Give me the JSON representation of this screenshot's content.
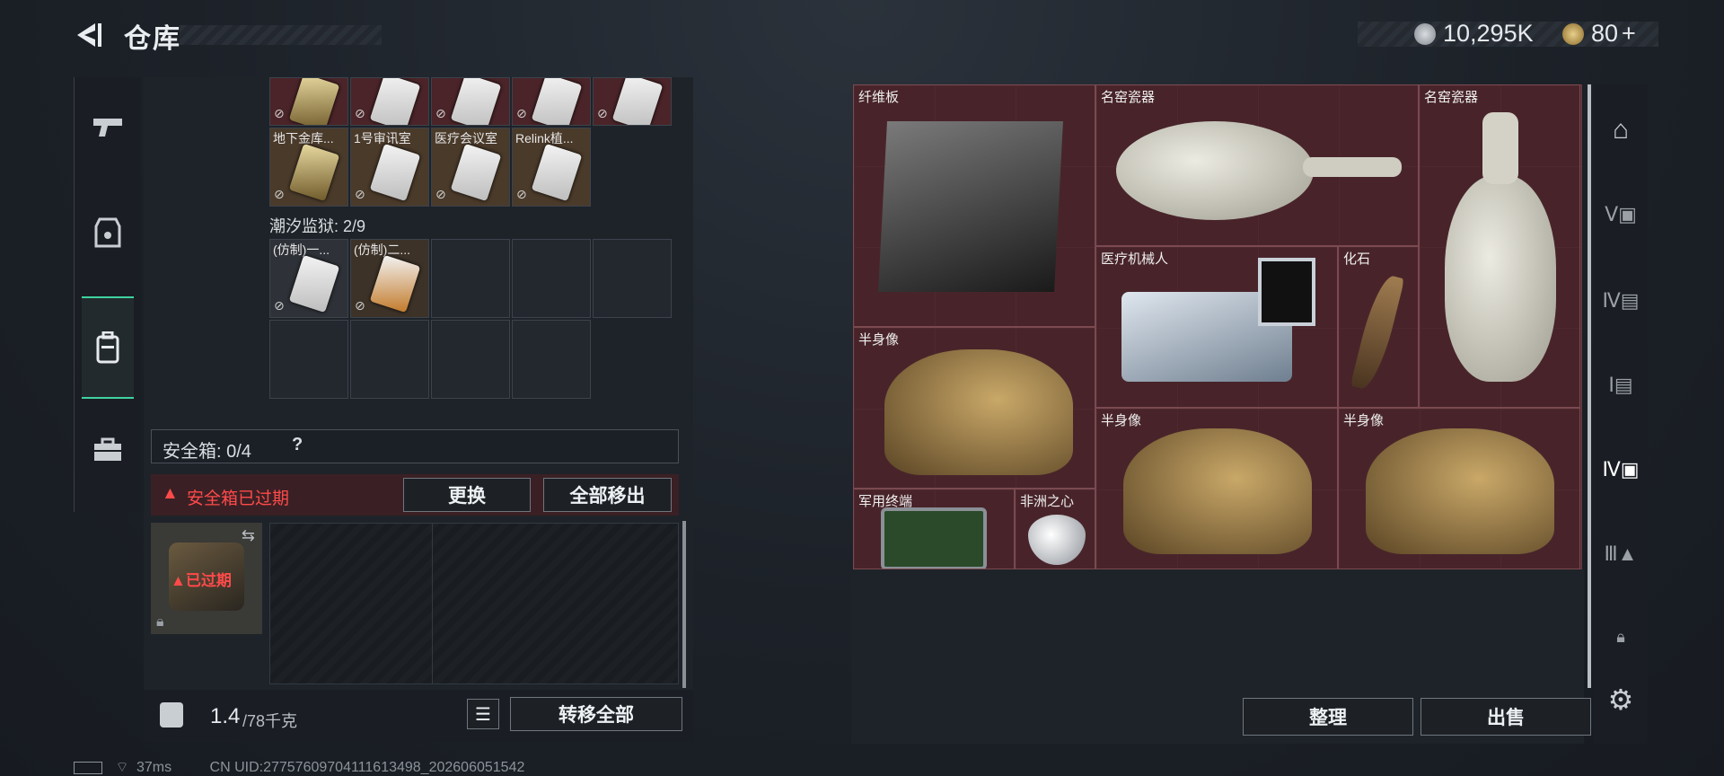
{
  "header": {
    "title": "仓库",
    "currency1": "10,295K",
    "currency2": "80"
  },
  "left": {
    "row1_labels": [
      "",
      "",
      "",
      "",
      ""
    ],
    "row2_labels": [
      "地下金库...",
      "1号审讯室",
      "医疗会议室",
      "Relink植..."
    ],
    "section_label": "潮汐监狱: 2/9",
    "prison_labels": [
      "(仿制)一...",
      "(仿制)二..."
    ],
    "safebox": {
      "label": "安全箱: 0/4",
      "help": "?"
    },
    "warning": "安全箱已过期",
    "replace_btn": "更换",
    "remove_all_btn": "全部移出",
    "expired_label": "已过期",
    "weight": {
      "current": "1.4",
      "max": "/78千克"
    },
    "transfer_btn": "转移全部"
  },
  "stash": {
    "items": [
      "纤维板",
      "名窑瓷器",
      "名窑瓷器",
      "医疗机械人",
      "化石",
      "半身像",
      "半身像",
      "半身像",
      "军用终端",
      "非洲之心"
    ],
    "sort_btn": "整理",
    "sell_btn": "出售"
  },
  "status": {
    "ping": "37ms",
    "uid": "CN UID:277576097041116134​98_202606051542"
  }
}
